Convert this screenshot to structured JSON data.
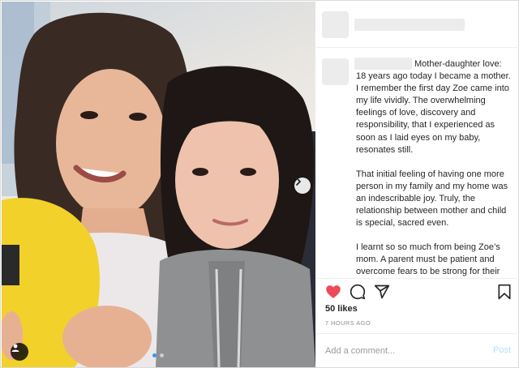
{
  "header": {
    "username": ""
  },
  "caption": {
    "paragraphs": [
      "Mother-daughter love: 18 years ago today I became a mother. I remember the first day Zoe came into my life vividly. The overwhelming feelings of love, discovery and responsibility, that I experienced as soon as I laid eyes on my baby, resonates still.",
      "That initial feeling of having one more person in my family and my home was an indescribable joy. Truly, the relationship between mother and child is special, sacred even.",
      "I learnt so so much from being Zoe’s mom. A parent must be patient and overcome fears to be strong for their kids. Because of my kids, I can and"
    ]
  },
  "actions": {
    "like_icon": "heart-filled-icon",
    "comment_icon": "comment-bubble-icon",
    "share_icon": "paper-plane-icon",
    "save_icon": "bookmark-icon",
    "like_color": "#ed4956"
  },
  "likes": "50 likes",
  "timestamp": "7 HOURS AGO",
  "comment": {
    "placeholder": "Add a comment...",
    "post_label": "Post"
  },
  "carousel": {
    "slides": 2,
    "current": 1
  },
  "colors": {
    "accent": "#3897f0",
    "post_disabled": "#b2dffc",
    "border": "#dbdbdb"
  }
}
